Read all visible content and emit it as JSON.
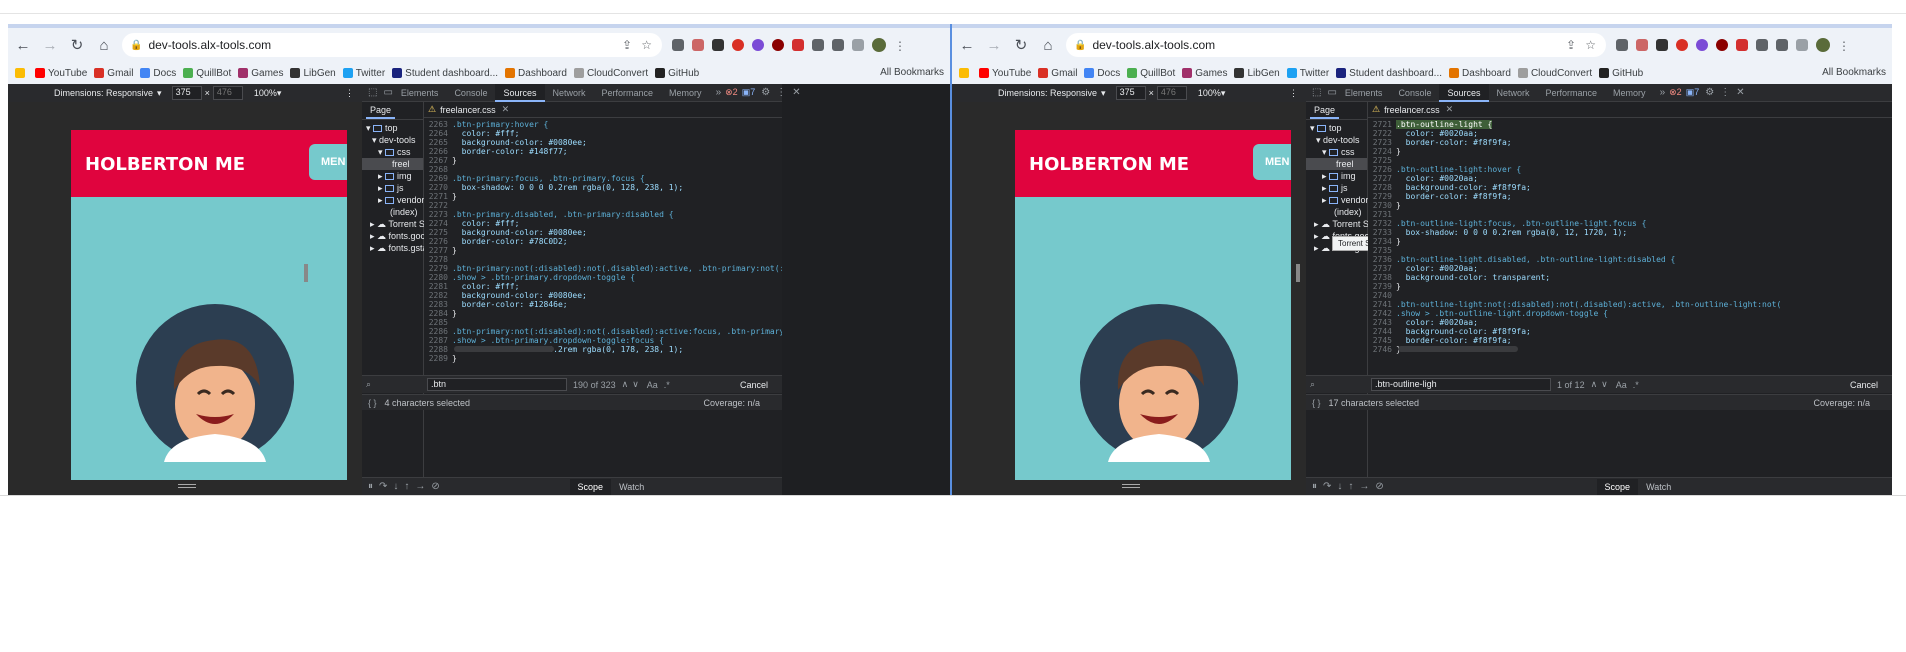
{
  "windows": [
    {
      "url": "dev-tools.alx-tools.com",
      "viewport": {
        "label": "Dimensions: Responsive",
        "width": "375",
        "height": "476",
        "zoom": "100%"
      },
      "page": {
        "title": "HOLBERTON ME",
        "menu": "MEN"
      },
      "devtools": {
        "tabs": [
          "Elements",
          "Console",
          "Sources",
          "Network",
          "Performance",
          "Memory"
        ],
        "errors": "2",
        "messages": "7",
        "nav_tab": "Page",
        "tree": [
          "top",
          "dev-tools",
          "css",
          "freel",
          "img",
          "js",
          "vendor",
          "(index)",
          "Torrent Sc",
          "fonts.goc",
          "fonts.gsta"
        ],
        "file": "freelancer.css",
        "search_value": ".btn",
        "search_count": "190 of 323",
        "cancel": "Cancel",
        "status": "4 characters selected",
        "coverage": "Coverage: n/a",
        "scope": "Scope",
        "watch": "Watch",
        "code": [
          [
            "2263",
            ".btn-primary:hover {"
          ],
          [
            "2264",
            "  color: #fff;"
          ],
          [
            "2265",
            "  background-color: #0080ee;"
          ],
          [
            "2266",
            "  border-color: #148f77;"
          ],
          [
            "2267",
            "}"
          ],
          [
            "2268",
            ""
          ],
          [
            "2269",
            ".btn-primary:focus, .btn-primary.focus {"
          ],
          [
            "2270",
            "  box-shadow: 0 0 0 0.2rem rgba(0, 128, 238, 1);"
          ],
          [
            "2271",
            "}"
          ],
          [
            "2272",
            ""
          ],
          [
            "2273",
            ".btn-primary.disabled, .btn-primary:disabled {"
          ],
          [
            "2274",
            "  color: #fff;"
          ],
          [
            "2275",
            "  background-color: #0080ee;"
          ],
          [
            "2276",
            "  border-color: #78C0D2;"
          ],
          [
            "2277",
            "}"
          ],
          [
            "2278",
            ""
          ],
          [
            "2279",
            ".btn-primary:not(:disabled):not(.disabled):active, .btn-primary:not(:disabled):"
          ],
          [
            "2280",
            ".show > .btn-primary.dropdown-toggle {"
          ],
          [
            "2281",
            "  color: #fff;"
          ],
          [
            "2282",
            "  background-color: #0080ee;"
          ],
          [
            "2283",
            "  border-color: #12846e;"
          ],
          [
            "2284",
            "}"
          ],
          [
            "2285",
            ""
          ],
          [
            "2286",
            ".btn-primary:not(:disabled):not(.disabled):active:focus, .btn-primary:not(:disab"
          ],
          [
            "2287",
            ".show > .btn-primary.dropdown-toggle:focus {"
          ],
          [
            "2288",
            "  box-shadow: 0 0 0 0.2rem rgba(0, 178, 238, 1);"
          ],
          [
            "2289",
            "}"
          ]
        ]
      }
    },
    {
      "url": "dev-tools.alx-tools.com",
      "viewport": {
        "label": "Dimensions: Responsive",
        "width": "375",
        "height": "476",
        "zoom": "100%"
      },
      "page": {
        "title": "HOLBERTON ME",
        "menu": "MEN"
      },
      "devtools": {
        "tabs": [
          "Elements",
          "Console",
          "Sources",
          "Network",
          "Performance",
          "Memory"
        ],
        "errors": "2",
        "messages": "7",
        "nav_tab": "Page",
        "tree": [
          "top",
          "dev-tools",
          "css",
          "freel",
          "img",
          "js",
          "vendor",
          "(index)",
          "Torrent Sc",
          "fonts.goo",
          "fonts.gst"
        ],
        "tooltip": "Torrent Scanner",
        "file": "freelancer.css",
        "search_value": ".btn-outline-ligh",
        "search_count": "1 of 12",
        "cancel": "Cancel",
        "status": "17 characters selected",
        "coverage": "Coverage: n/a",
        "scope": "Scope",
        "watch": "Watch",
        "code": [
          [
            "2721",
            ".btn-outline-light {"
          ],
          [
            "2722",
            "  color: #0020aa;"
          ],
          [
            "2723",
            "  border-color: #f8f9fa;"
          ],
          [
            "2724",
            "}"
          ],
          [
            "2725",
            ""
          ],
          [
            "2726",
            ".btn-outline-light:hover {"
          ],
          [
            "2727",
            "  color: #0020aa;"
          ],
          [
            "2728",
            "  background-color: #f8f9fa;"
          ],
          [
            "2729",
            "  border-color: #f8f9fa;"
          ],
          [
            "2730",
            "}"
          ],
          [
            "2731",
            ""
          ],
          [
            "2732",
            ".btn-outline-light:focus, .btn-outline-light.focus {"
          ],
          [
            "2733",
            "  box-shadow: 0 0 0 0.2rem rgba(0, 12, 1720, 1);"
          ],
          [
            "2734",
            "}"
          ],
          [
            "2735",
            ""
          ],
          [
            "2736",
            ".btn-outline-light.disabled, .btn-outline-light:disabled {"
          ],
          [
            "2737",
            "  color: #0020aa;"
          ],
          [
            "2738",
            "  background-color: transparent;"
          ],
          [
            "2739",
            "}"
          ],
          [
            "2740",
            ""
          ],
          [
            "2741",
            ".btn-outline-light:not(:disabled):not(.disabled):active, .btn-outline-light:not("
          ],
          [
            "2742",
            ".show > .btn-outline-light.dropdown-toggle {"
          ],
          [
            "2743",
            "  color: #0020aa;"
          ],
          [
            "2744",
            "  background-color: #f8f9fa;"
          ],
          [
            "2745",
            "  border-color: #f8f9fa;"
          ],
          [
            "2746",
            "}"
          ]
        ]
      }
    }
  ],
  "bookmarks": [
    "YouTube",
    "Gmail",
    "Docs",
    "QuillBot",
    "Games",
    "LibGen",
    "Twitter",
    "Student dashboard...",
    "Dashboard",
    "CloudConvert",
    "GitHub"
  ],
  "bookmark_colors": [
    "#ff0000",
    "#d93025",
    "#4285f4",
    "#4caf50",
    "#a0306a",
    "#333333",
    "#1da1f2",
    "#1a237e",
    "#e37400",
    "#9e9e9e",
    "#222222"
  ],
  "all_bookmarks": "All Bookmarks",
  "colors": {
    "page_red": "#e0043e",
    "page_teal": "#76c9cc",
    "avatar_bg": "#2c3e51",
    "accent": "#8ab4f8"
  }
}
